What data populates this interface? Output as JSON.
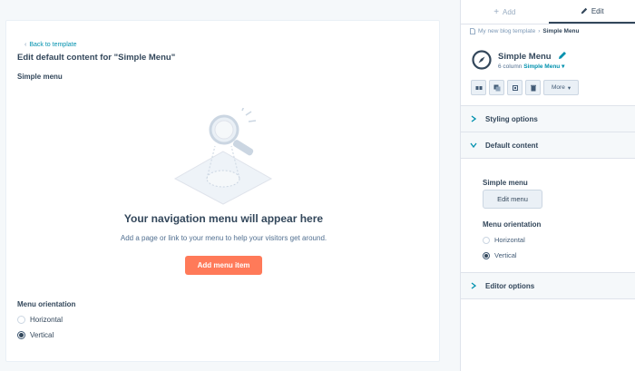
{
  "editor": {
    "back_link": "Back to template",
    "title": "Edit default content for \"Simple Menu\"",
    "section_label": "Simple menu",
    "empty_heading": "Your navigation menu will appear here",
    "empty_subtext": "Add a page or link to your menu to help your visitors get around.",
    "add_button": "Add menu item",
    "orientation_label": "Menu orientation",
    "orientation_options": [
      {
        "label": "Horizontal",
        "selected": false
      },
      {
        "label": "Vertical",
        "selected": true
      }
    ]
  },
  "panel": {
    "tabs": [
      {
        "label": "Add",
        "icon": "plus-icon",
        "active": false
      },
      {
        "label": "Edit",
        "icon": "pencil-icon",
        "active": true
      }
    ],
    "breadcrumb": {
      "parent": "My new blog template",
      "current": "Simple Menu"
    },
    "module": {
      "name": "Simple Menu",
      "icon": "compass-icon",
      "columns": "6 column",
      "type": "Simple Menu"
    },
    "toolbar": {
      "more_label": "More",
      "icons": [
        "inspect-icon",
        "clone-icon",
        "resize-icon",
        "delete-icon"
      ]
    },
    "sections": {
      "styling": "Styling options",
      "default_content": "Default content",
      "editor": "Editor options"
    },
    "default_content": {
      "menu_label": "Simple menu",
      "edit_button": "Edit menu",
      "orientation_label": "Menu orientation",
      "orientation_options": [
        {
          "label": "Horizontal",
          "selected": false
        },
        {
          "label": "Vertical",
          "selected": true
        }
      ]
    }
  },
  "colors": {
    "accent": "#0091ae",
    "primary_button": "#ff7a59",
    "text": "#33475b",
    "panel_bg": "#f5f8fa"
  }
}
